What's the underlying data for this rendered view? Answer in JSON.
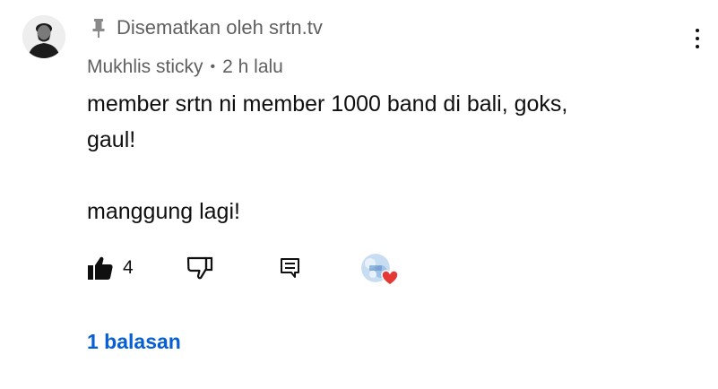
{
  "pinned": {
    "label": "Disematkan oleh srtn.tv",
    "icon": "pin-icon"
  },
  "comment": {
    "author": "Mukhlis sticky",
    "separator": "•",
    "time": "2 h lalu",
    "text_lines": [
      "member srtn ni member 1000 band di bali, goks,",
      "gaul!",
      "manggung lagi!"
    ]
  },
  "actions": {
    "like_count": "4",
    "like_icon": "thumbs-up-filled-icon",
    "dislike_icon": "thumbs-down-icon",
    "reply_icon": "comment-reply-icon",
    "creator_heart_icon": "creator-heart-icon"
  },
  "menu": {
    "icon": "more-vertical-icon"
  },
  "replies": {
    "label": "1 balasan"
  },
  "colors": {
    "meta_text": "#606060",
    "body_text": "#0f0f0f",
    "link": "#065fd4",
    "heart": "#e53935"
  }
}
